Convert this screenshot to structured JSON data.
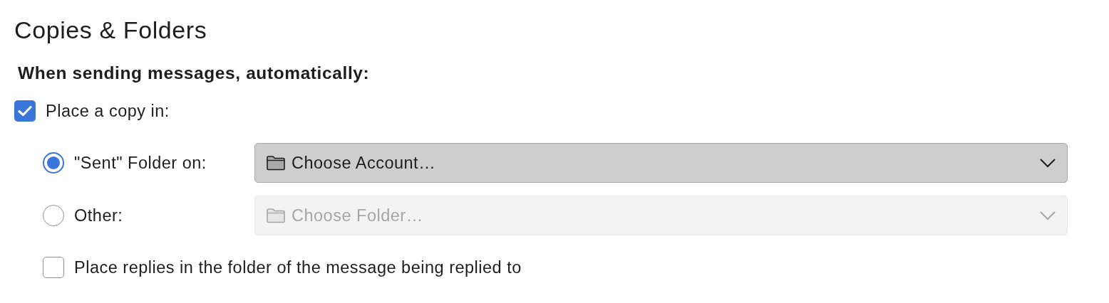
{
  "title": "Copies & Folders",
  "section_heading": "When sending messages, automatically:",
  "place_copy": {
    "label": "Place a copy in:",
    "checked": true
  },
  "destinations": [
    {
      "label": "\"Sent\" Folder on:",
      "selected": true,
      "dropdown": {
        "value": "Choose Account…",
        "disabled": false
      }
    },
    {
      "label": "Other:",
      "selected": false,
      "dropdown": {
        "value": "Choose Folder…",
        "disabled": true
      }
    }
  ],
  "place_replies": {
    "label": "Place replies in the folder of the message being replied to",
    "checked": false
  }
}
